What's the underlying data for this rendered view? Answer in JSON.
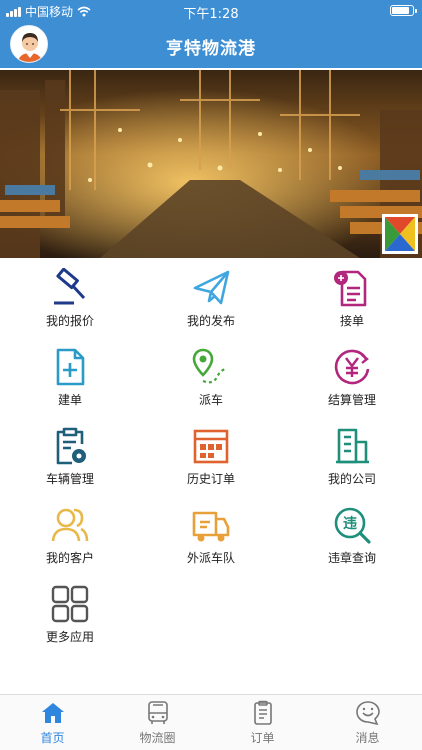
{
  "status_bar": {
    "carrier": "中国移动",
    "time": "下午1:28",
    "battery_level": 0.9
  },
  "header": {
    "title": "亨特物流港"
  },
  "menu": [
    {
      "label": "我的报价",
      "icon": "auction-hammer-icon",
      "color": "#1e3a8a"
    },
    {
      "label": "我的发布",
      "icon": "paper-plane-icon",
      "color": "#3fa6e0"
    },
    {
      "label": "接单",
      "icon": "accept-order-document-icon",
      "color": "#b3267d"
    },
    {
      "label": "建单",
      "icon": "create-document-icon",
      "color": "#2a9bc6"
    },
    {
      "label": "派车",
      "icon": "dispatch-route-pin-icon",
      "color": "#46a83a"
    },
    {
      "label": "结算管理",
      "icon": "settlement-yen-icon",
      "color": "#b3267d"
    },
    {
      "label": "车辆管理",
      "icon": "vehicle-clipboard-gear-icon",
      "color": "#1f5f7a"
    },
    {
      "label": "历史订单",
      "icon": "history-orders-calendar-icon",
      "color": "#e0622f"
    },
    {
      "label": "我的公司",
      "icon": "company-building-icon",
      "color": "#1e8f7a"
    },
    {
      "label": "我的客户",
      "icon": "customers-people-icon",
      "color": "#e8b84a"
    },
    {
      "label": "外派车队",
      "icon": "fleet-truck-icon",
      "color": "#e8a03a"
    },
    {
      "label": "违章查询",
      "icon": "violation-search-icon",
      "color": "#1e8f7a"
    },
    {
      "label": "更多应用",
      "icon": "more-apps-grid-icon",
      "color": "#555555"
    }
  ],
  "tabs": [
    {
      "label": "首页",
      "icon": "home-icon",
      "active": true
    },
    {
      "label": "物流圈",
      "icon": "bus-icon",
      "active": false
    },
    {
      "label": "订单",
      "icon": "clipboard-list-icon",
      "active": false
    },
    {
      "label": "消息",
      "icon": "smiley-chat-icon",
      "active": false
    }
  ],
  "colors": {
    "primary": "#3d8ed3",
    "tab_active": "#2e86de",
    "tab_inactive": "#777777"
  }
}
